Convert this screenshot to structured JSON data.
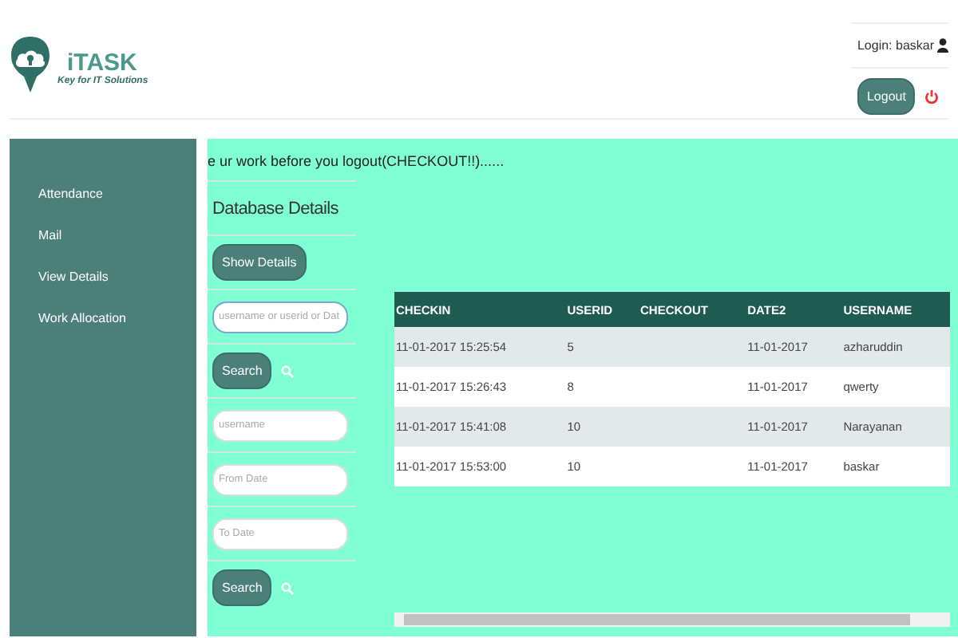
{
  "logo": {
    "name": "iTASK",
    "tagline": "Key for IT Solutions"
  },
  "user": {
    "login": "Login: baskar",
    "logout": "Logout"
  },
  "sidebar": {
    "items": [
      "Attendance",
      "Mail",
      "View Details",
      "Work Allocation"
    ]
  },
  "notice": "e ur work before you logout(CHECKOUT!!)......",
  "form": {
    "title": "Database Details",
    "show_button": "Show Details",
    "search_field": {
      "placeholder": "username or userid or Dat"
    },
    "search_button": "Search",
    "fields": [
      {
        "placeholder": "username"
      },
      {
        "placeholder": "From Date"
      },
      {
        "placeholder": "To Date"
      }
    ],
    "search_button_2": "Search"
  },
  "table": {
    "columns": [
      "CHECKIN",
      "USERID",
      "CHECKOUT",
      "DATE2",
      "USERNAME"
    ],
    "rows": [
      [
        "11-01-2017 15:25:54",
        "5",
        "",
        "11-01-2017",
        "azharuddin"
      ],
      [
        "11-01-2017 15:26:43",
        "8",
        "",
        "11-01-2017",
        "qwerty"
      ],
      [
        "11-01-2017 15:41:08",
        "10",
        "",
        "11-01-2017",
        "Narayanan"
      ],
      [
        "11-01-2017 15:53:00",
        "10",
        "",
        "11-01-2017",
        "baskar"
      ]
    ]
  }
}
